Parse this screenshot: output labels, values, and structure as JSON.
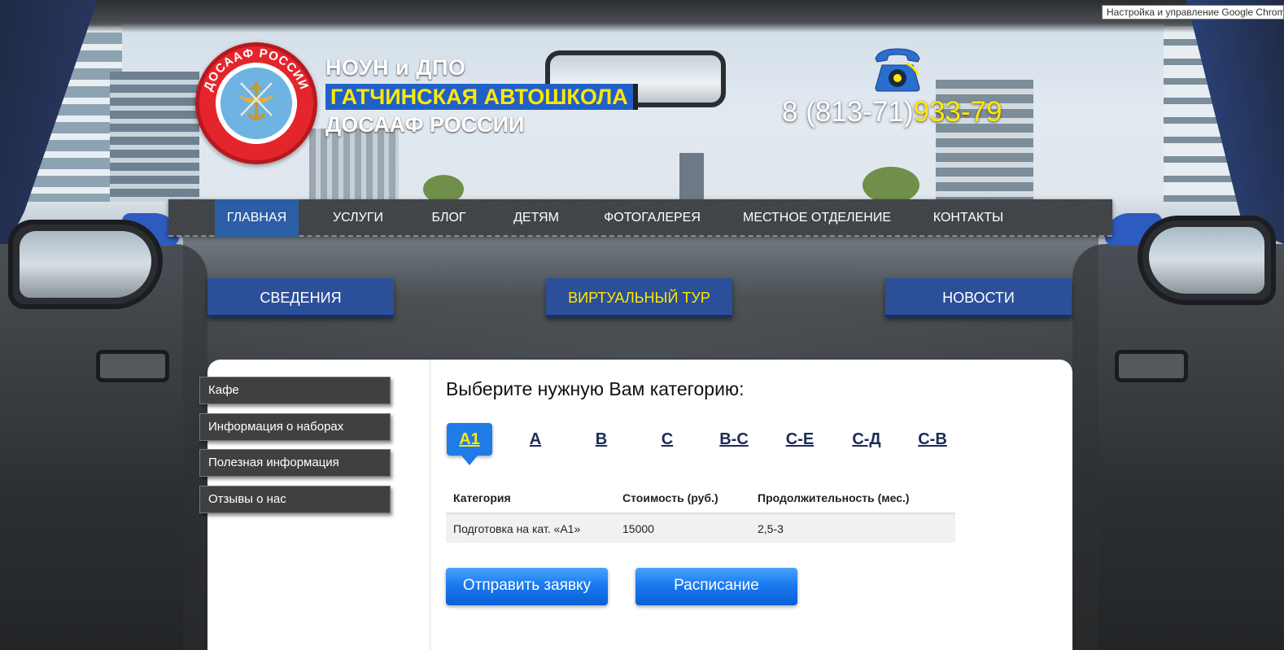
{
  "tooltip": "Настройка и управление Google Chrome",
  "header": {
    "org_line1": "НОУН и ДПО",
    "org_line2": "ГАТЧИНСКАЯ АВТОШКОЛА",
    "org_line3": "ДОСААФ РОССИИ",
    "logo_text": "ДОСААФ РОССИИ",
    "phone_prefix": "8 (813-71)",
    "phone_number": "933-79",
    "phone_icon": "telephone-icon"
  },
  "nav": {
    "items": [
      {
        "label": "ГЛАВНАЯ"
      },
      {
        "label": "УСЛУГИ"
      },
      {
        "label": "БЛОГ"
      },
      {
        "label": "ДЕТЯМ"
      },
      {
        "label": "ФОТОГАЛЕРЕЯ"
      },
      {
        "label": "МЕСТНОЕ ОТДЕЛЕНИЕ"
      },
      {
        "label": "КОНТАКТЫ"
      }
    ],
    "active": "ГЛАВНАЯ"
  },
  "big_buttons": {
    "info": "СВЕДЕНИЯ",
    "tour": "ВИРТУАЛЬНЫЙ ТУР",
    "news": "НОВОСТИ"
  },
  "sidebar": {
    "items": [
      {
        "label": "Кафе"
      },
      {
        "label": "Информация о наборах"
      },
      {
        "label": "Полезная информация"
      },
      {
        "label": "Отзывы о нас"
      }
    ]
  },
  "main": {
    "heading": "Выберите нужную Вам категорию:",
    "categories": [
      "А1",
      "А",
      "В",
      "С",
      "В-С",
      "С-Е",
      "С-Д",
      "С-В"
    ],
    "selected_category": "А1",
    "table": {
      "headers": [
        "Категория",
        "Стоимость (руб.)",
        "Продолжительность (мес.)"
      ],
      "rows": [
        [
          "Подготовка на кат. «А1»",
          "15000",
          "2,5-3"
        ]
      ]
    },
    "apply_button": "Отправить заявку",
    "schedule_button": "Расписание"
  },
  "colors": {
    "nav_active": "#2c5ea7",
    "big_button": "#2c4f9a",
    "highlight_yellow": "#ffe800",
    "action_blue": "#1a7bf0"
  }
}
